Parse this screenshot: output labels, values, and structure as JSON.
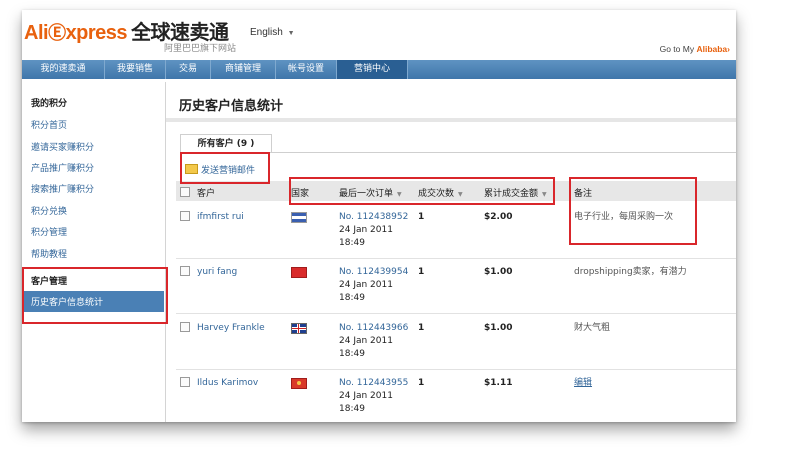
{
  "header": {
    "logo_ali": "Ali",
    "logo_cart": "Ⓔ",
    "logo_xpress": "xpress",
    "logo_cn": "全球速卖通",
    "logo_sub": "阿里巴巴旗下网站",
    "language": "English",
    "goto_label": "Go to My",
    "goto_brand": "Alibaba",
    "goto_arrow": "›"
  },
  "nav": {
    "tabs": [
      "我的速卖通",
      "我要销售",
      "交易",
      "商铺管理",
      "帐号设置",
      "营销中心"
    ],
    "active": "营销中心"
  },
  "sidebar": {
    "section1": "我的积分",
    "items1": [
      "积分首页",
      "邀请买家赚积分",
      "产品推广赚积分",
      "搜索推广赚积分",
      "积分兑换",
      "积分管理",
      "帮助教程"
    ],
    "section2": "客户管理",
    "active_item": "历史客户信息统计"
  },
  "main": {
    "title": "历史客户信息统计",
    "subtab": "所有客户 (9 )",
    "send_mail": "发送营销邮件",
    "columns": {
      "customer": "客户",
      "country": "国家",
      "last_order": "最后一次订单",
      "order_count": "成交次数",
      "total_amount": "累计成交金额",
      "note": "备注"
    },
    "rows": [
      {
        "name": "ifmfirst rui",
        "flag": "flag-icon",
        "order_no": "No. 112438952",
        "date": "24 Jan 2011",
        "time": "18:49",
        "count": "1",
        "amount": "$2.00",
        "note": "电子行业，每周采购一次"
      },
      {
        "name": "yuri fang",
        "flag": "flag-icon",
        "order_no": "No. 112439954",
        "date": "24 Jan 2011",
        "time": "18:49",
        "count": "1",
        "amount": "$1.00",
        "note": "dropshipping卖家，有潜力"
      },
      {
        "name": "Harvey Frankle",
        "flag": "flag-icon",
        "order_no": "No. 112443966",
        "date": "24 Jan 2011",
        "time": "18:49",
        "count": "1",
        "amount": "$1.00",
        "note": "财大气粗"
      },
      {
        "name": "Ildus Karimov",
        "flag": "flag-icon",
        "order_no": "No. 112443955",
        "date": "24 Jan 2011",
        "time": "18:49",
        "count": "1",
        "amount": "$1.11",
        "note": "编辑"
      }
    ]
  },
  "colors": {
    "brand": "#e8610e",
    "nav": "#4a80b5",
    "link": "#336699",
    "highlight": "#d9262b"
  }
}
